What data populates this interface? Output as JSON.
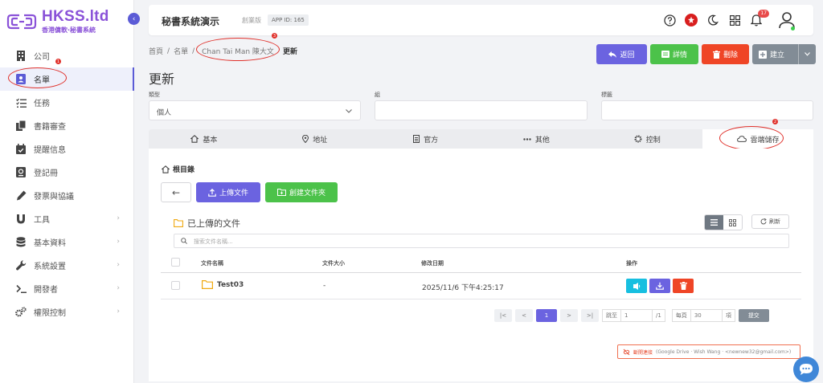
{
  "brand": {
    "name": "HKSS.ltd",
    "subtitle": "香港傭軟·秘書系統",
    "color": "#8a52d8"
  },
  "sidebar": {
    "items": [
      {
        "label": "公司",
        "icon": "building-icon"
      },
      {
        "label": "名單",
        "icon": "contact-card-icon",
        "active": true
      },
      {
        "label": "任務",
        "icon": "tasks-icon"
      },
      {
        "label": "書籍審查",
        "icon": "copy-icon"
      },
      {
        "label": "提醒信息",
        "icon": "calendar-check-icon"
      },
      {
        "label": "登記冊",
        "icon": "register-icon"
      },
      {
        "label": "發票與協議",
        "icon": "pen-icon"
      },
      {
        "label": "工具",
        "icon": "magnet-icon",
        "has_children": true
      },
      {
        "label": "基本資料",
        "icon": "database-icon",
        "has_children": true
      },
      {
        "label": "系統設置",
        "icon": "wrench-icon",
        "has_children": true
      },
      {
        "label": "開發者",
        "icon": "terminal-icon",
        "has_children": true
      },
      {
        "label": "權限控制",
        "icon": "cogs-icon",
        "has_children": true
      }
    ]
  },
  "topbar": {
    "title": "秘書系統演示",
    "edition": "創業版",
    "app_id": "APP ID: 165",
    "notification_count": "17"
  },
  "breadcrumb": {
    "home": "首頁",
    "sep": "/",
    "list": "名單",
    "contact": "Chan Tai Man 陳大文",
    "current": "更新"
  },
  "actions": {
    "back": "返回",
    "detail": "詳情",
    "delete": "刪除",
    "create": "建立"
  },
  "page": {
    "title": "更新"
  },
  "form": {
    "type_label": "類型",
    "type_value": "個人",
    "group_label": "組",
    "group_value": "",
    "tag_label": "標籤",
    "tag_value": ""
  },
  "tabs": [
    {
      "label": "基本",
      "icon": "home-icon"
    },
    {
      "label": "地址",
      "icon": "location-pin-icon"
    },
    {
      "label": "官方",
      "icon": "document-icon"
    },
    {
      "label": "其他",
      "icon": "ellipsis-icon"
    },
    {
      "label": "控制",
      "icon": "gear-icon"
    },
    {
      "label": "雲端儲存",
      "icon": "cloud-icon",
      "active": true
    }
  ],
  "storage": {
    "root_label": "根目錄",
    "upload_label": "上傳文件",
    "mkdir_label": "創建文件夾",
    "uploaded_title": "已上傳的文件",
    "refresh_label": "刷新",
    "search_placeholder": "搜索文件名稱...",
    "columns": {
      "name": "文件名稱",
      "size": "文件大小",
      "modified": "修改日期",
      "ops": "操作"
    },
    "files": [
      {
        "name": "Test03",
        "size": "-",
        "modified": "2025/11/6 下午4:25:17"
      }
    ]
  },
  "pagination": {
    "first": "|<",
    "prev": "<",
    "current": "1",
    "next": ">",
    "last": ">|",
    "goto_label": "跳至",
    "goto_value": "1",
    "total": "/1",
    "per_page_label": "每頁",
    "per_page_value": "30",
    "per_page_unit": "項",
    "submit": "提交"
  },
  "disconnect": {
    "label": "斷開連接",
    "info": "(Google Drive · Wish Wang · <newnew32@gmail.com>)"
  },
  "annotations": {
    "marker1": "1",
    "marker2": "2",
    "marker3": "3"
  },
  "colors": {
    "primary": "#6b63e0",
    "success": "#4cc24a",
    "danger": "#ef4526",
    "secondary": "#828c96",
    "info": "#17bfe0",
    "annotation": "#e0302a"
  }
}
